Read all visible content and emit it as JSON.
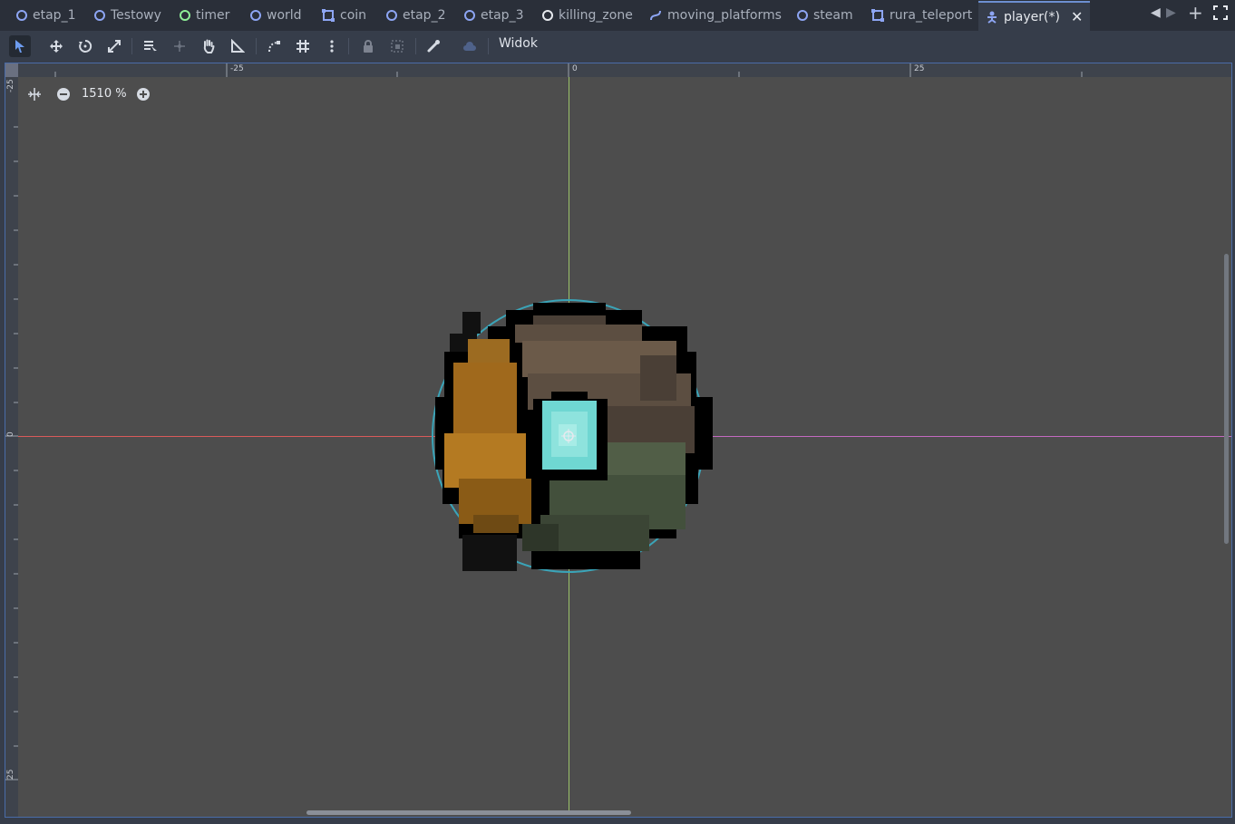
{
  "tabs": [
    {
      "label": "etap_1",
      "icon": "node-ring-icon"
    },
    {
      "label": "Testowy",
      "icon": "node-ring-icon"
    },
    {
      "label": "timer",
      "icon": "node-ring-green-icon"
    },
    {
      "label": "world",
      "icon": "node-ring-icon"
    },
    {
      "label": "coin",
      "icon": "area2d-icon"
    },
    {
      "label": "etap_2",
      "icon": "node-ring-icon"
    },
    {
      "label": "etap_3",
      "icon": "node-ring-icon"
    },
    {
      "label": "killing_zone",
      "icon": "node-ring-white-icon"
    },
    {
      "label": "moving_platforms",
      "icon": "path-icon"
    },
    {
      "label": "steam",
      "icon": "node-ring-icon"
    },
    {
      "label": "rura_teleport",
      "icon": "area2d-icon"
    },
    {
      "label": "player(*)",
      "icon": "character-icon",
      "active": true
    }
  ],
  "toolbar": {
    "tools": [
      "select-tool-icon",
      "move-tool-icon",
      "rotate-tool-icon",
      "scale-tool-icon",
      "list-select-icon",
      "pivot-icon",
      "pan-tool-icon",
      "ruler-tool-icon",
      "smart-snap-icon",
      "grid-snap-icon",
      "more-options-icon",
      "lock-icon",
      "group-icon",
      "skeleton-icon",
      "cloud-icon"
    ],
    "view_menu": "Widok"
  },
  "viewport": {
    "zoom_label": "1510 %",
    "ruler_top": [
      "-25",
      "0",
      "25"
    ],
    "ruler_left": [
      "-25",
      "0",
      "25"
    ]
  },
  "colors": {
    "accent": "#6d8fd1",
    "viewport_bg": "#4d4d4d",
    "x_axis": "#d95a5a",
    "y_axis": "#9bc26a"
  }
}
